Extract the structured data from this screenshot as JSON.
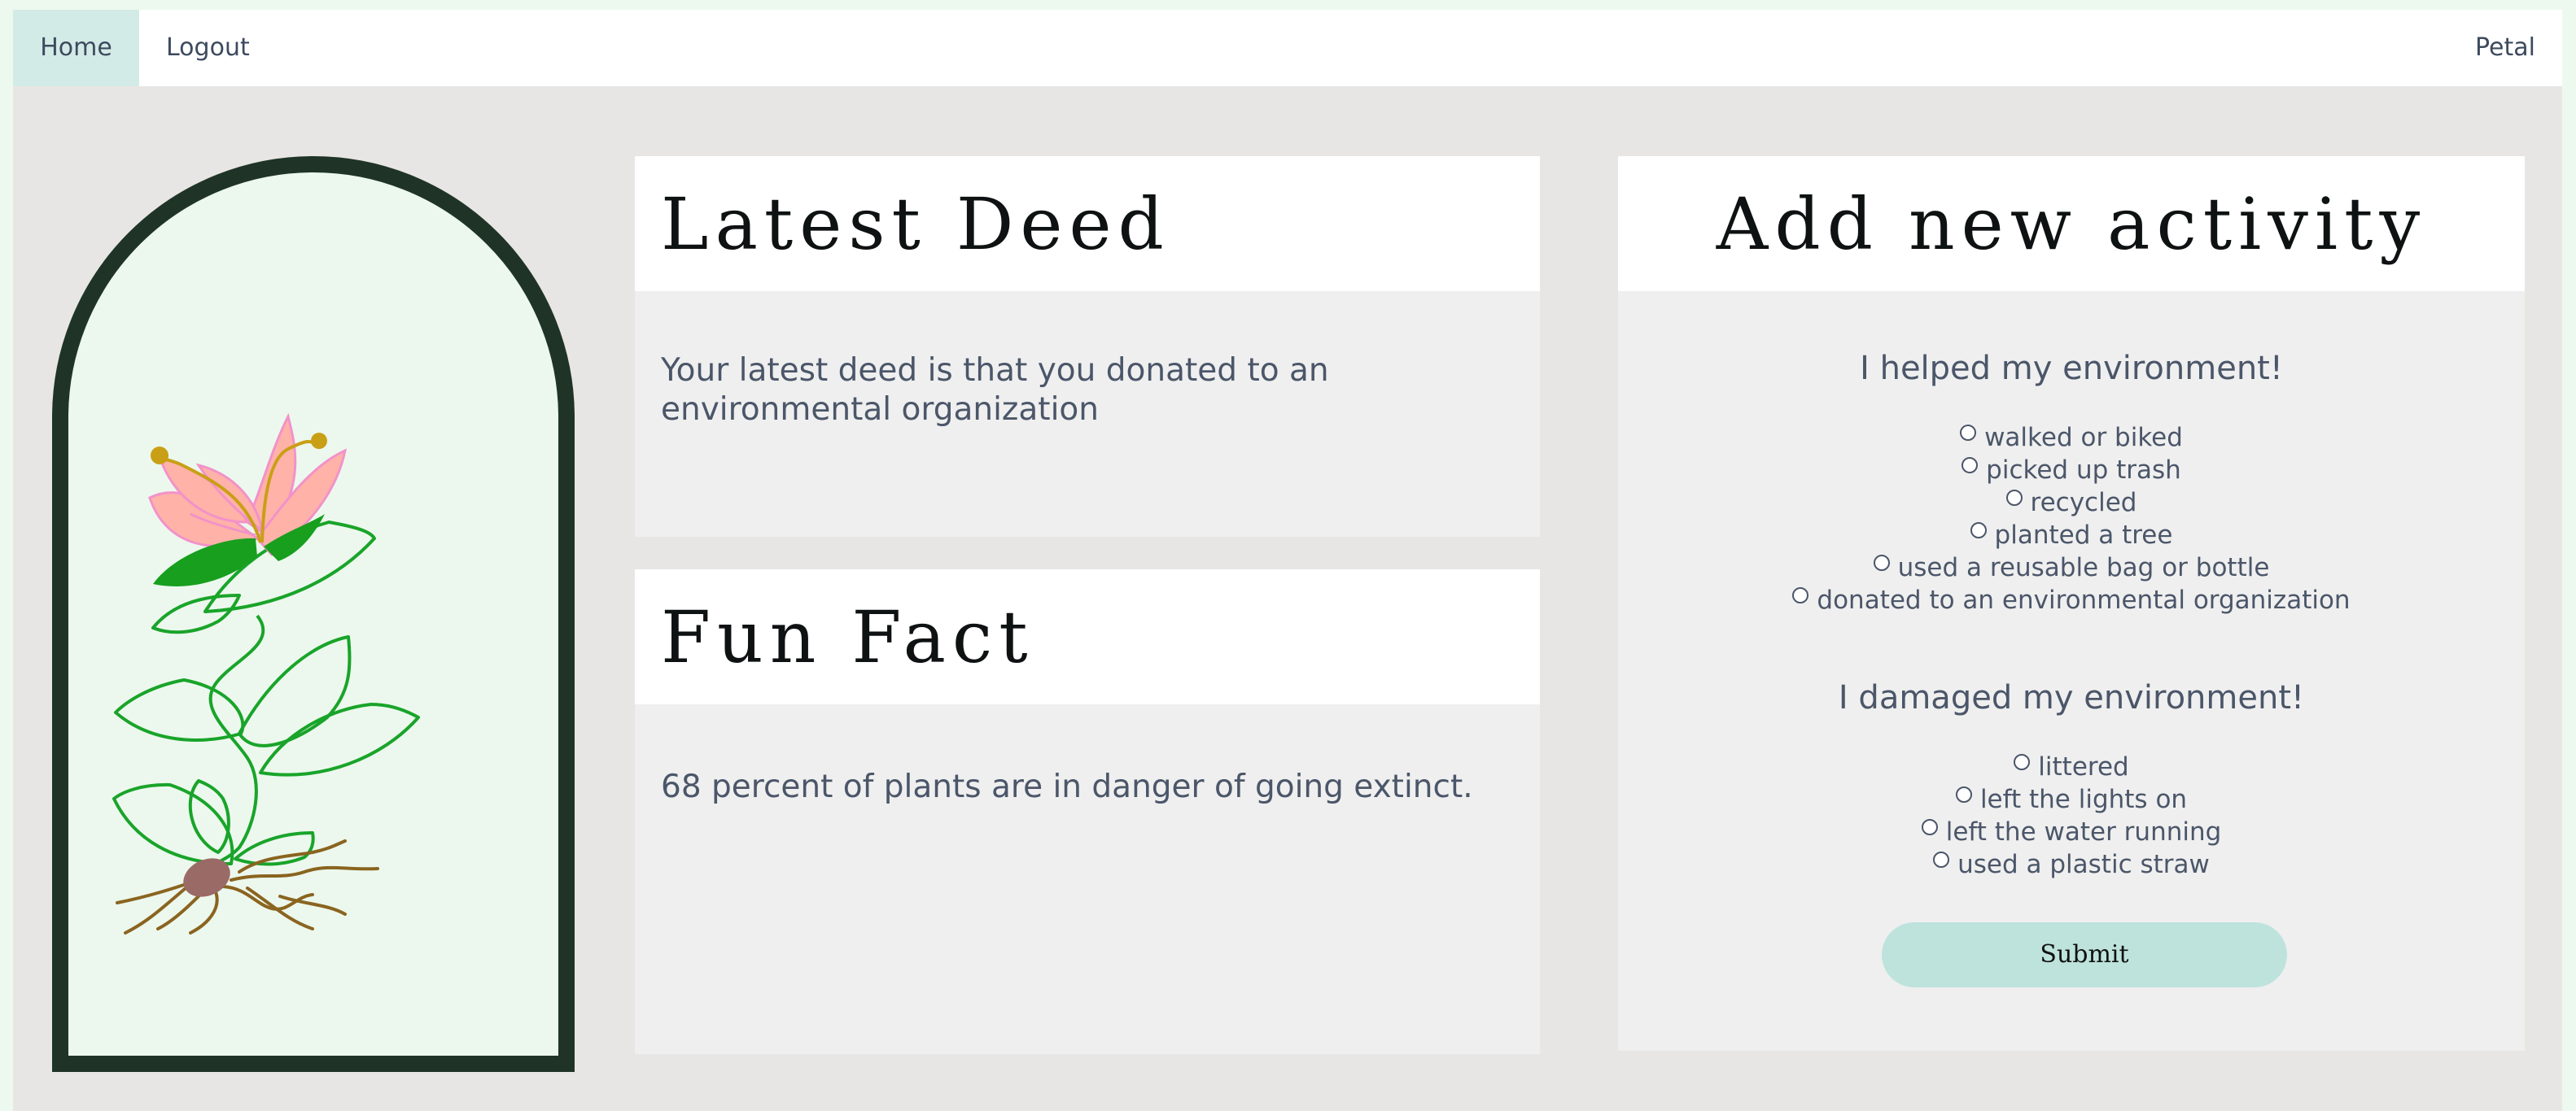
{
  "nav": {
    "home_label": "Home",
    "logout_label": "Logout",
    "brand": "Petal"
  },
  "latest_deed": {
    "title": "Latest Deed",
    "text": "Your latest deed is that you donated to an environmental organization"
  },
  "fun_fact": {
    "title": "Fun Fact",
    "text": "68 percent of plants are in danger of going extinct."
  },
  "add_activity": {
    "title": "Add new activity",
    "helped_heading": "I helped my environment!",
    "helped_options": [
      "walked or biked",
      "picked up trash",
      "recycled",
      "planted a tree",
      "used a reusable bag or bottle",
      "donated to an environmental organization"
    ],
    "damaged_heading": "I damaged my environment!",
    "damaged_options": [
      "littered",
      "left the lights on",
      "left the water running",
      "used a plastic straw"
    ],
    "submit_label": "Submit"
  },
  "colors": {
    "page_background": "#e8e6e4",
    "nav_active": "#d3ebe6",
    "arch_border": "#1f3427",
    "arch_fill": "#ecf8ed",
    "button": "#bde3dc",
    "petal": "#ffb2a8",
    "leaf_stroke": "#19a42a"
  },
  "illustration": "flower-plant-illustration"
}
